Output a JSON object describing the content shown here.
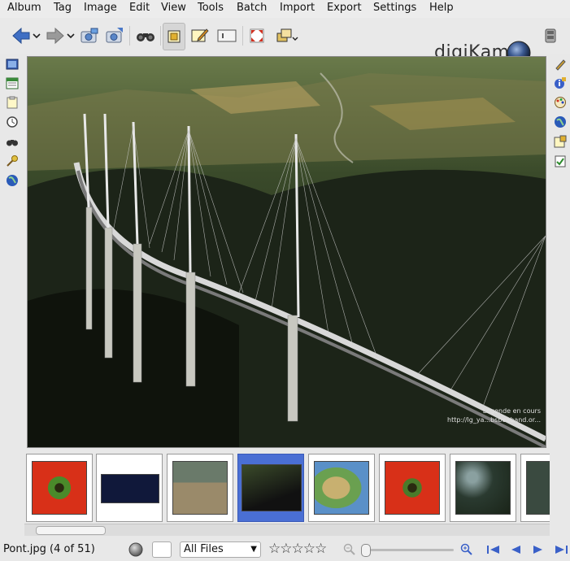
{
  "menu": [
    "Album",
    "Tag",
    "Image",
    "Edit",
    "View",
    "Tools",
    "Batch",
    "Import",
    "Export",
    "Settings",
    "Help"
  ],
  "app_logo_text": "digiKam",
  "toolbar_icons": [
    "back-arrow-icon",
    "forward-arrow-icon",
    "album-camera-icon",
    "import-camera-icon",
    "binoculars-search-icon",
    "preview-mode-icon",
    "edit-icon",
    "slideshow-icon",
    "fullscreen-icon",
    "windows-icon",
    "right-settings-icon"
  ],
  "viewer": {
    "watermark_line1": "Légende en cours",
    "watermark_line2": "http://lg_ya...bsbeaband.or..."
  },
  "filmstrip": {
    "selected_index": 3,
    "thumbs": [
      {
        "name": "flower-red"
      },
      {
        "name": "world-map-dark"
      },
      {
        "name": "people-scooters"
      },
      {
        "name": "bridge"
      },
      {
        "name": "north-america-map"
      },
      {
        "name": "flower-red-2"
      },
      {
        "name": "forest-water"
      },
      {
        "name": "partial"
      }
    ]
  },
  "status": {
    "file_label": "Pont.jpg (4 of 51)",
    "filter_selected": "All Files",
    "rating_stars": "☆☆☆☆☆",
    "zoom_level": 0.0
  },
  "colors": {
    "accent_selection": "#4a6fd4",
    "background": "#e8e8e8"
  }
}
